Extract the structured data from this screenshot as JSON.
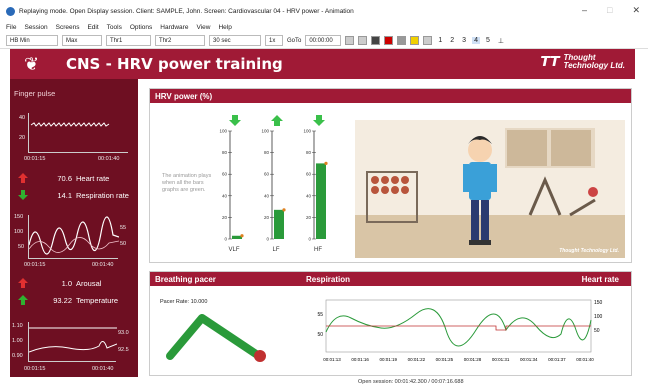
{
  "window": {
    "title": "Replaying mode. Open Display session. Client: SAMPLE, John. Screen: Cardiovascular 04 - HRV power - Animation",
    "buttons": {
      "minimize": "–",
      "maximize": "□",
      "close": "✕"
    }
  },
  "menu": [
    "File",
    "Session",
    "Screens",
    "Edit",
    "Tools",
    "Options",
    "Hardware",
    "View",
    "Help"
  ],
  "toolbar": {
    "field1": "HB  Min",
    "field2": "Max",
    "field3": "Thr1",
    "field4": "Thr2",
    "timescale": "30 sec",
    "speed": "1x",
    "goto_label": "GoTo",
    "goto_value": "00:00:00",
    "screen_numbers": [
      "1",
      "2",
      "3",
      "4",
      "5"
    ],
    "selected_screen": "4"
  },
  "header": {
    "title": "CNS - HRV power training",
    "brand_line1": "Thought",
    "brand_line2": "Technology Ltd."
  },
  "left_panel": {
    "title": "Finger pulse",
    "pulse_chart": {
      "yticks": [
        "40",
        "20"
      ],
      "xticks": [
        "00:01:15",
        "00:01:40"
      ]
    },
    "stats": [
      {
        "value": "70.6",
        "label": "Heart rate",
        "arrow": "up",
        "color": "#e03030"
      },
      {
        "value": "14.1",
        "label": "Respiration rate",
        "arrow": "down",
        "color": "#30b030"
      }
    ],
    "hr_chart": {
      "yticks_left": [
        "150",
        "100",
        "50"
      ],
      "yticks_right": [
        "55",
        "50"
      ],
      "xticks": [
        "00:01:15",
        "00:01:40"
      ]
    },
    "stats2": [
      {
        "value": "1.0",
        "label": "Arousal",
        "arrow": "up",
        "color": "#e03030"
      },
      {
        "value": "93.22",
        "label": "Temperature",
        "arrow": "up",
        "color": "#30b030"
      }
    ],
    "temp_chart": {
      "yticks_left": [
        "1.10",
        "1.00",
        "0.90"
      ],
      "yticks_right": [
        "93.0",
        "92.5"
      ],
      "xticks": [
        "00:01:15",
        "00:01:40"
      ]
    }
  },
  "hrv_panel": {
    "title": "HRV power (%)",
    "note": "The animation plays when all the bars graphs are green.",
    "bars": [
      {
        "label": "VLF",
        "value": 3,
        "arrow": "down"
      },
      {
        "label": "LF",
        "value": 27,
        "arrow": "up"
      },
      {
        "label": "HF",
        "value": 70,
        "arrow": "down"
      }
    ],
    "yticks": [
      "100",
      "80",
      "60",
      "40",
      "20",
      "0"
    ],
    "scene_watermark": "Thought Technology Ltd."
  },
  "bottom_panel": {
    "pacer_title": "Breathing pacer",
    "pacer_rate": "Pacer Rate: 10.000",
    "resp_title": "Respiration",
    "hr_title": "Heart rate",
    "yticks_left": [
      "55",
      "50"
    ],
    "yticks_right": [
      "150",
      "100",
      "50"
    ],
    "xticks": [
      "00:01:13",
      "00:01:16",
      "00:01:19",
      "00:01:22",
      "00:01:25",
      "00:01:28",
      "00:01:31",
      "00:01:34",
      "00:01:37",
      "00:01:40"
    ]
  },
  "footer": {
    "text": "Open session: 00:01:42.300 / 00:07:16.688"
  },
  "colors": {
    "header": "#a01a36",
    "left_panel": "#6e0f22",
    "bar": "#2a9a3a",
    "resp_line": "#2a9a3a",
    "hr_line": "#c03030"
  }
}
